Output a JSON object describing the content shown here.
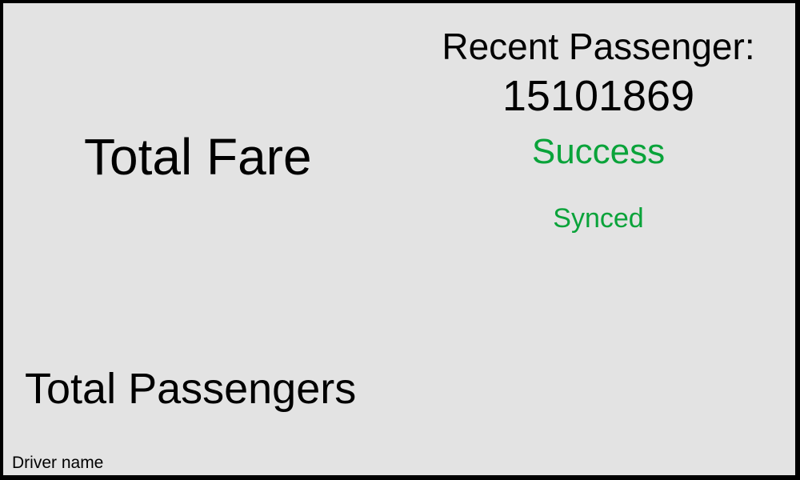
{
  "colors": {
    "border": "#000000",
    "background": "#e3e3e3",
    "text": "#000000",
    "status_ok": "#0aa33a"
  },
  "fare": {
    "label": "Total Fare"
  },
  "passengers": {
    "label": "Total Passengers"
  },
  "driver": {
    "label": "Driver name"
  },
  "recent": {
    "label": "Recent Passenger:",
    "id": "15101869",
    "status": "Success",
    "sync": "Synced"
  }
}
